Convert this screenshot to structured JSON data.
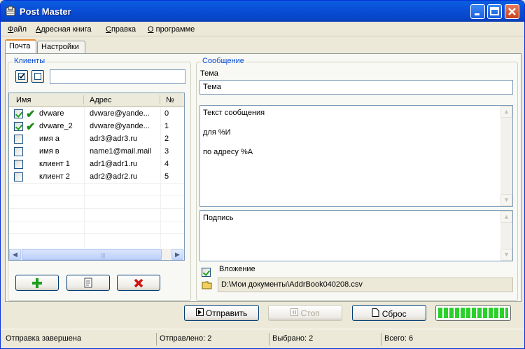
{
  "window": {
    "title": "Post Master"
  },
  "menu": [
    "Файл",
    "Адресная книга",
    "Справка",
    "О программе"
  ],
  "tabs": [
    "Почта",
    "Настройки"
  ],
  "clients": {
    "legend": "Клиенты",
    "filter_value": "",
    "columns": [
      "Имя",
      "Адрес",
      "№"
    ],
    "rows": [
      {
        "checked": true,
        "sent": true,
        "name": "dvware",
        "address": "dvware@yande...",
        "num": "0"
      },
      {
        "checked": true,
        "sent": true,
        "name": "dvware_2",
        "address": "dvware@yande...",
        "num": "1"
      },
      {
        "checked": false,
        "sent": false,
        "name": "имя а",
        "address": "adr3@adr3.ru",
        "num": "2"
      },
      {
        "checked": false,
        "sent": false,
        "name": "имя в",
        "address": "name1@mail.mail",
        "num": "3"
      },
      {
        "checked": false,
        "sent": false,
        "name": "клиент 1",
        "address": "adr1@adr1.ru",
        "num": "4"
      },
      {
        "checked": false,
        "sent": false,
        "name": "клиент 2",
        "address": "adr2@adr2.ru",
        "num": "5"
      }
    ]
  },
  "message": {
    "legend": "Сообщение",
    "subject_label": "Тема",
    "subject_value": "Тема",
    "body_lines": [
      "Текст сообщения",
      "",
      "для  %И",
      "",
      "по адресу  %А"
    ],
    "signature": "Подпись",
    "attachment_label": "Вложение",
    "attachment_checked": true,
    "attachment_path": "D:\\Мои документы\\AddrBook040208.csv"
  },
  "actions": {
    "send": "Отправить",
    "stop": "Стоп",
    "reset": "Сброс"
  },
  "progress_fraction": 1.0,
  "status": {
    "message": "Отправка завершена",
    "sent": "Отправлено: 2",
    "selected": "Выбрано: 2",
    "total": "Всего: 6"
  },
  "colors": {
    "titlebar": "#0a4fd8",
    "legend": "#0046d5",
    "progress": "#2bd02b",
    "add_icon": "#1e9e1e",
    "delete_icon": "#d01010"
  },
  "icons": [
    "mail-app-icon",
    "minimize-icon",
    "maximize-icon",
    "close-icon",
    "check-all-icon",
    "uncheck-all-icon",
    "add-icon",
    "import-icon",
    "delete-icon",
    "play-icon",
    "pause-icon",
    "document-icon",
    "folder-icon"
  ]
}
